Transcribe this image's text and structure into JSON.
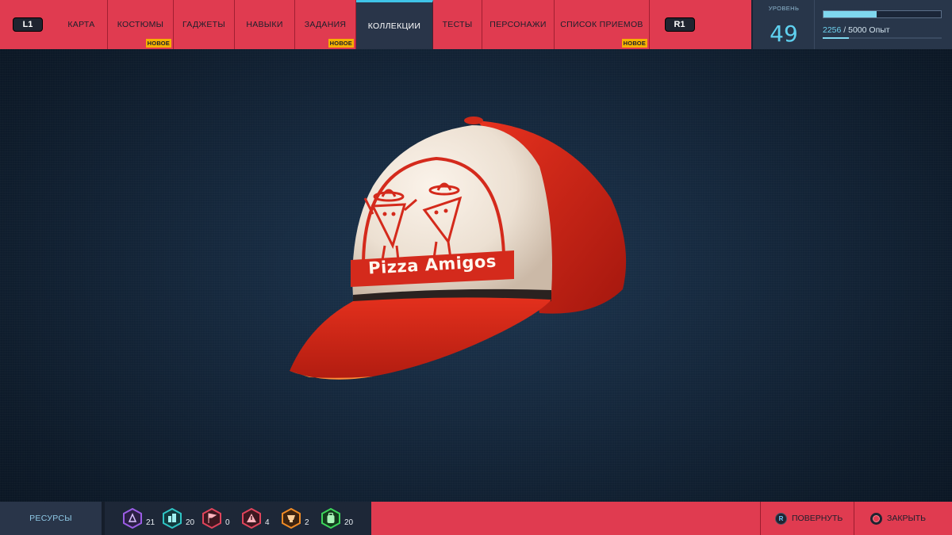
{
  "nav": {
    "left_shoulder": "L1",
    "right_shoulder": "R1",
    "tabs": [
      {
        "label": "КАРТА",
        "badge": ""
      },
      {
        "label": "КОСТЮМЫ",
        "badge": "НОВОЕ"
      },
      {
        "label": "ГАДЖЕТЫ",
        "badge": ""
      },
      {
        "label": "НАВЫКИ",
        "badge": ""
      },
      {
        "label": "ЗАДАНИЯ",
        "badge": "НОВОЕ"
      },
      {
        "label": "КОЛЛЕКЦИИ",
        "badge": ""
      },
      {
        "label": "ТЕСТЫ",
        "badge": ""
      },
      {
        "label": "ПЕРСОНАЖИ",
        "badge": ""
      },
      {
        "label": "СПИСОК ПРИЕМОВ",
        "badge": "НОВОЕ"
      }
    ],
    "active_tab": "КОЛЛЕКЦИИ"
  },
  "level": {
    "caption": "УРОВЕНЬ",
    "value": "49",
    "xp_current": "2256",
    "xp_separator": " / ",
    "xp_total": "5000 Опыт",
    "xp_progress": 0.45
  },
  "item": {
    "cap_text": "Pizza Amigos"
  },
  "resources": {
    "label": "РЕСУРСЫ",
    "items": [
      {
        "icon": "science-token-icon",
        "count": "21",
        "color": "#9b5de5"
      },
      {
        "icon": "city-token-icon",
        "count": "20",
        "color": "#2ec4c4"
      },
      {
        "icon": "flag-token-icon",
        "count": "0",
        "color": "#e0445b"
      },
      {
        "icon": "crime-token-icon",
        "count": "4",
        "color": "#e0445b"
      },
      {
        "icon": "challenge-token-icon",
        "count": "2",
        "color": "#f08a24"
      },
      {
        "icon": "backpack-token-icon",
        "count": "20",
        "color": "#3cd45a"
      }
    ]
  },
  "actions": {
    "rotate_button_glyph": "R",
    "rotate_label": "ПОВЕРНУТЬ",
    "close_label": "ЗАКРЫТЬ"
  },
  "colors": {
    "accent_red": "#e03b50",
    "panel_navy": "#293549",
    "highlight_cyan": "#3fc4e8",
    "badge_yellow": "#f5b100"
  }
}
